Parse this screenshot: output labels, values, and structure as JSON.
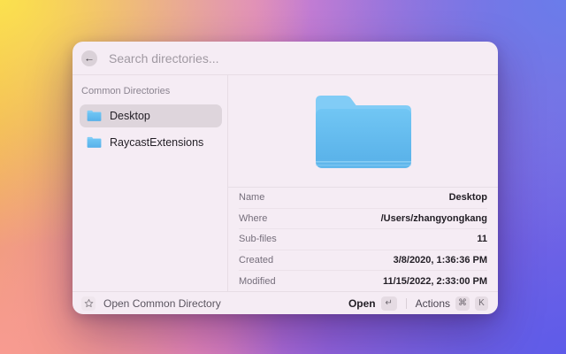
{
  "window": {
    "search": {
      "placeholder": "Search directories..."
    },
    "sidebar": {
      "section_title": "Common Directories",
      "items": [
        {
          "label": "Desktop",
          "selected": true
        },
        {
          "label": "RaycastExtensions",
          "selected": false
        }
      ]
    },
    "details": {
      "rows": [
        {
          "label": "Name",
          "value": "Desktop"
        },
        {
          "label": "Where",
          "value": "/Users/zhangyongkang"
        },
        {
          "label": "Sub-files",
          "value": "11"
        },
        {
          "label": "Created",
          "value": "3/8/2020, 1:36:36 PM"
        },
        {
          "label": "Modified",
          "value": "11/15/2022, 2:33:00 PM"
        }
      ]
    },
    "footer": {
      "command_name": "Open Common Directory",
      "primary_action": "Open",
      "primary_key": "↵",
      "secondary_action": "Actions",
      "secondary_keys": [
        "⌘",
        "K"
      ]
    },
    "icons": {
      "back": "←",
      "folder": "folder-icon",
      "star": "star-icon"
    },
    "colors": {
      "window_bg": "#f5ecf4",
      "selection_bg": "#ded5dc",
      "divider": "#e7dde5",
      "folder_tab": "#81ccf6",
      "folder_body_top": "#6fc5f4",
      "folder_body_bottom": "#57b0e9",
      "bg_corner_top_left": "#fbe14e",
      "bg_corner_top_right": "#6a7cea",
      "bg_corner_bottom_left": "#f89b91",
      "bg_corner_bottom_right": "#5e5be9",
      "bg_center_pink": "#dc81ce"
    }
  }
}
